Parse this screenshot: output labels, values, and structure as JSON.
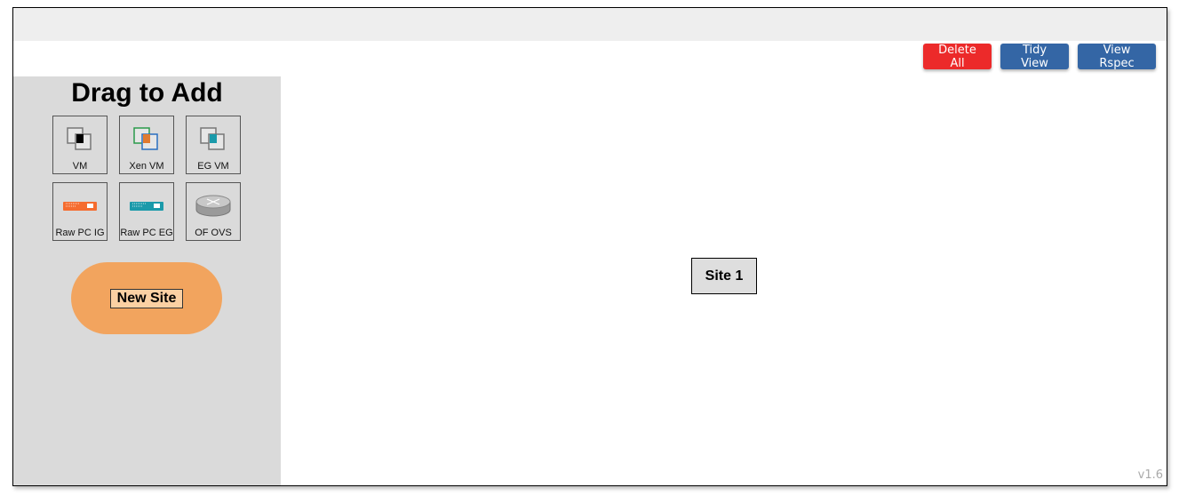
{
  "toolbar": {
    "delete_all_label": "Delete All",
    "tidy_view_label": "Tidy View",
    "view_rspec_label": "View Rspec"
  },
  "palette": {
    "title": "Drag to Add",
    "items": [
      {
        "label": "VM",
        "icon": "vm-icon"
      },
      {
        "label": "Xen VM",
        "icon": "xen-vm-icon"
      },
      {
        "label": "EG VM",
        "icon": "eg-vm-icon"
      },
      {
        "label": "Raw PC IG",
        "icon": "raw-pc-ig-icon"
      },
      {
        "label": "Raw PC EG",
        "icon": "raw-pc-eg-icon"
      },
      {
        "label": "OF OVS",
        "icon": "ovs-router-icon"
      }
    ],
    "new_site_label": "New Site"
  },
  "canvas": {
    "sites": [
      {
        "label": "Site 1"
      }
    ]
  },
  "version": "v1.6",
  "colors": {
    "danger": "#ec2a2a",
    "primary": "#3466a5",
    "palette_bg": "#dadada",
    "new_site": "#f2a45e",
    "ig_orange": "#f56c2f",
    "eg_teal": "#1b9aaa"
  }
}
